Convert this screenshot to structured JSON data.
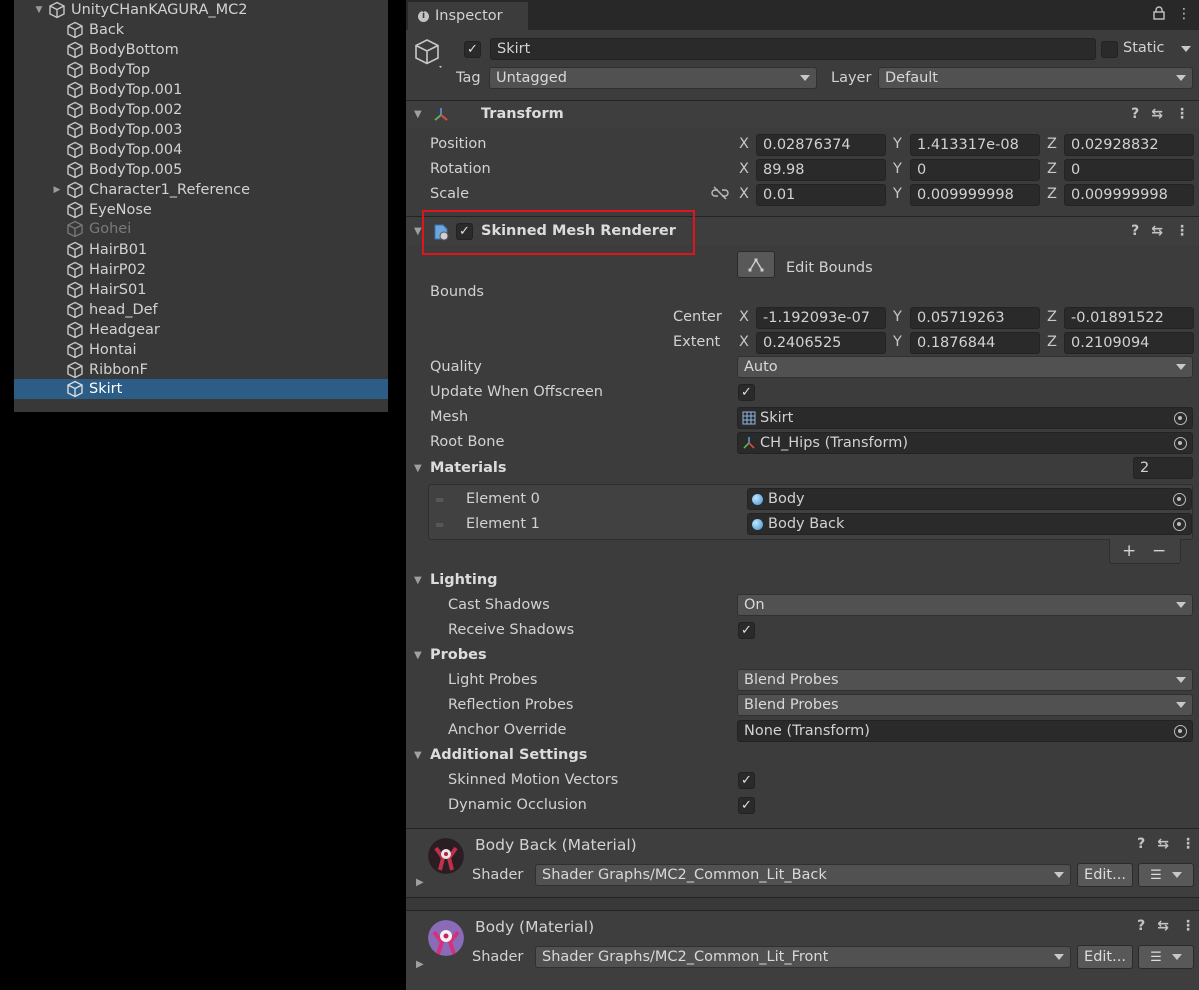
{
  "hierarchy": {
    "root": "UnityCHanKAGURA_MC2",
    "items": [
      {
        "label": "Back"
      },
      {
        "label": "BodyBottom"
      },
      {
        "label": "BodyTop"
      },
      {
        "label": "BodyTop.001"
      },
      {
        "label": "BodyTop.002"
      },
      {
        "label": "BodyTop.003"
      },
      {
        "label": "BodyTop.004"
      },
      {
        "label": "BodyTop.005"
      },
      {
        "label": "Character1_Reference"
      },
      {
        "label": "EyeNose"
      },
      {
        "label": "Gohei"
      },
      {
        "label": "HairB01"
      },
      {
        "label": "HairP02"
      },
      {
        "label": "HairS01"
      },
      {
        "label": "head_Def"
      },
      {
        "label": "Headgear"
      },
      {
        "label": "Hontai"
      },
      {
        "label": "RibbonF"
      },
      {
        "label": "Skirt"
      }
    ]
  },
  "inspector": {
    "tab": "Inspector",
    "object": {
      "name": "Skirt",
      "static_label": "Static",
      "tag_label": "Tag",
      "tag_value": "Untagged",
      "layer_label": "Layer",
      "layer_value": "Default"
    },
    "transform": {
      "title": "Transform",
      "position": {
        "label": "Position",
        "x": "0.02876374",
        "y": "1.413317e-08",
        "z": "0.02928832"
      },
      "rotation": {
        "label": "Rotation",
        "x": "89.98",
        "y": "0",
        "z": "0"
      },
      "scale": {
        "label": "Scale",
        "x": "0.01",
        "y": "0.009999998",
        "z": "0.009999998"
      }
    },
    "axes": {
      "x": "X",
      "y": "Y",
      "z": "Z"
    },
    "smr": {
      "title": "Skinned Mesh Renderer",
      "edit_bounds": "Edit Bounds",
      "bounds_label": "Bounds",
      "center": {
        "label": "Center",
        "x": "-1.192093e-07",
        "y": "0.05719263",
        "z": "-0.01891522"
      },
      "extent": {
        "label": "Extent",
        "x": "0.2406525",
        "y": "0.1876844",
        "z": "0.2109094"
      },
      "quality_label": "Quality",
      "quality_value": "Auto",
      "update_offscreen_label": "Update When Offscreen",
      "mesh_label": "Mesh",
      "mesh_value": "Skirt",
      "root_bone_label": "Root Bone",
      "root_bone_value": "CH_Hips (Transform)",
      "materials_label": "Materials",
      "materials_count": "2",
      "elements": [
        {
          "label": "Element 0",
          "value": "Body"
        },
        {
          "label": "Element 1",
          "value": "Body Back"
        }
      ],
      "plus": "+",
      "minus": "−",
      "lighting_label": "Lighting",
      "cast_shadows_label": "Cast Shadows",
      "cast_shadows_value": "On",
      "receive_shadows_label": "Receive Shadows",
      "probes_label": "Probes",
      "light_probes_label": "Light Probes",
      "light_probes_value": "Blend Probes",
      "reflection_probes_label": "Reflection Probes",
      "reflection_probes_value": "Blend Probes",
      "anchor_override_label": "Anchor Override",
      "anchor_override_value": "None (Transform)",
      "additional_label": "Additional Settings",
      "skinned_motion_label": "Skinned Motion Vectors",
      "dynamic_occlusion_label": "Dynamic Occlusion"
    },
    "materials": [
      {
        "title": "Body Back (Material)",
        "shader_label": "Shader",
        "shader_value": "Shader Graphs/MC2_Common_Lit_Back",
        "edit_label": "Edit..."
      },
      {
        "title": "Body (Material)",
        "shader_label": "Shader",
        "shader_value": "Shader Graphs/MC2_Common_Lit_Front",
        "edit_label": "Edit..."
      }
    ]
  },
  "colors": {
    "selection": "#2c5d87",
    "highlight_box": "#e0141c",
    "panel": "#3c3c3c",
    "field": "#2a2a2a"
  }
}
